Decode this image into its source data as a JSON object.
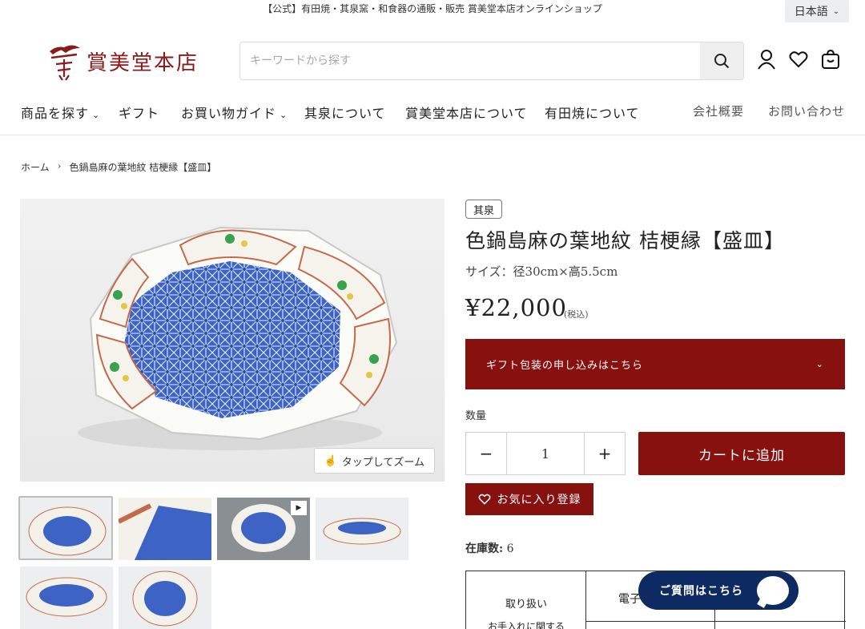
{
  "header": {
    "notice": "【公式】有田焼・其泉窯・和食器の通販・販売 賞美堂本店オンラインショップ",
    "language": "日本語",
    "brand": "賞美堂本店",
    "search_placeholder": "キーワードから探す"
  },
  "nav": {
    "items": [
      "商品を探す",
      "ギフト",
      "お買い物ガイド",
      "其泉について",
      "賞美堂本店について",
      "有田焼について"
    ],
    "utility": [
      "会社概要",
      "お問い合わせ"
    ]
  },
  "breadcrumb": {
    "home": "ホーム",
    "separator": "›",
    "current": "色鍋島麻の葉地紋 桔梗縁【盛皿】"
  },
  "gallery": {
    "zoom_label": "タップしてズーム"
  },
  "product": {
    "vendor": "其泉",
    "title": "色鍋島麻の葉地紋 桔梗縁【盛皿】",
    "size": "サイズ：径30cm×高5.5cm",
    "price": "¥22,000",
    "tax_note": "(税込)",
    "gift_label": "ギフト包装の申し込みはこちら",
    "qty_label": "数量",
    "qty_value": "1",
    "minus": "−",
    "plus": "+",
    "add_to_cart": "カートに追加",
    "favorite": "お気に入り登録",
    "stock_label": "在庫数:",
    "stock_value": "6"
  },
  "spec_table": {
    "key1": "取り扱い",
    "key2": "お手入れに関する",
    "val1": "電子"
  },
  "chat": {
    "label": "ご質問はこちら"
  },
  "colors": {
    "brand_red": "#86110f",
    "chat_navy": "#0e2a63",
    "porcelain_blue": "#3d63c4"
  }
}
